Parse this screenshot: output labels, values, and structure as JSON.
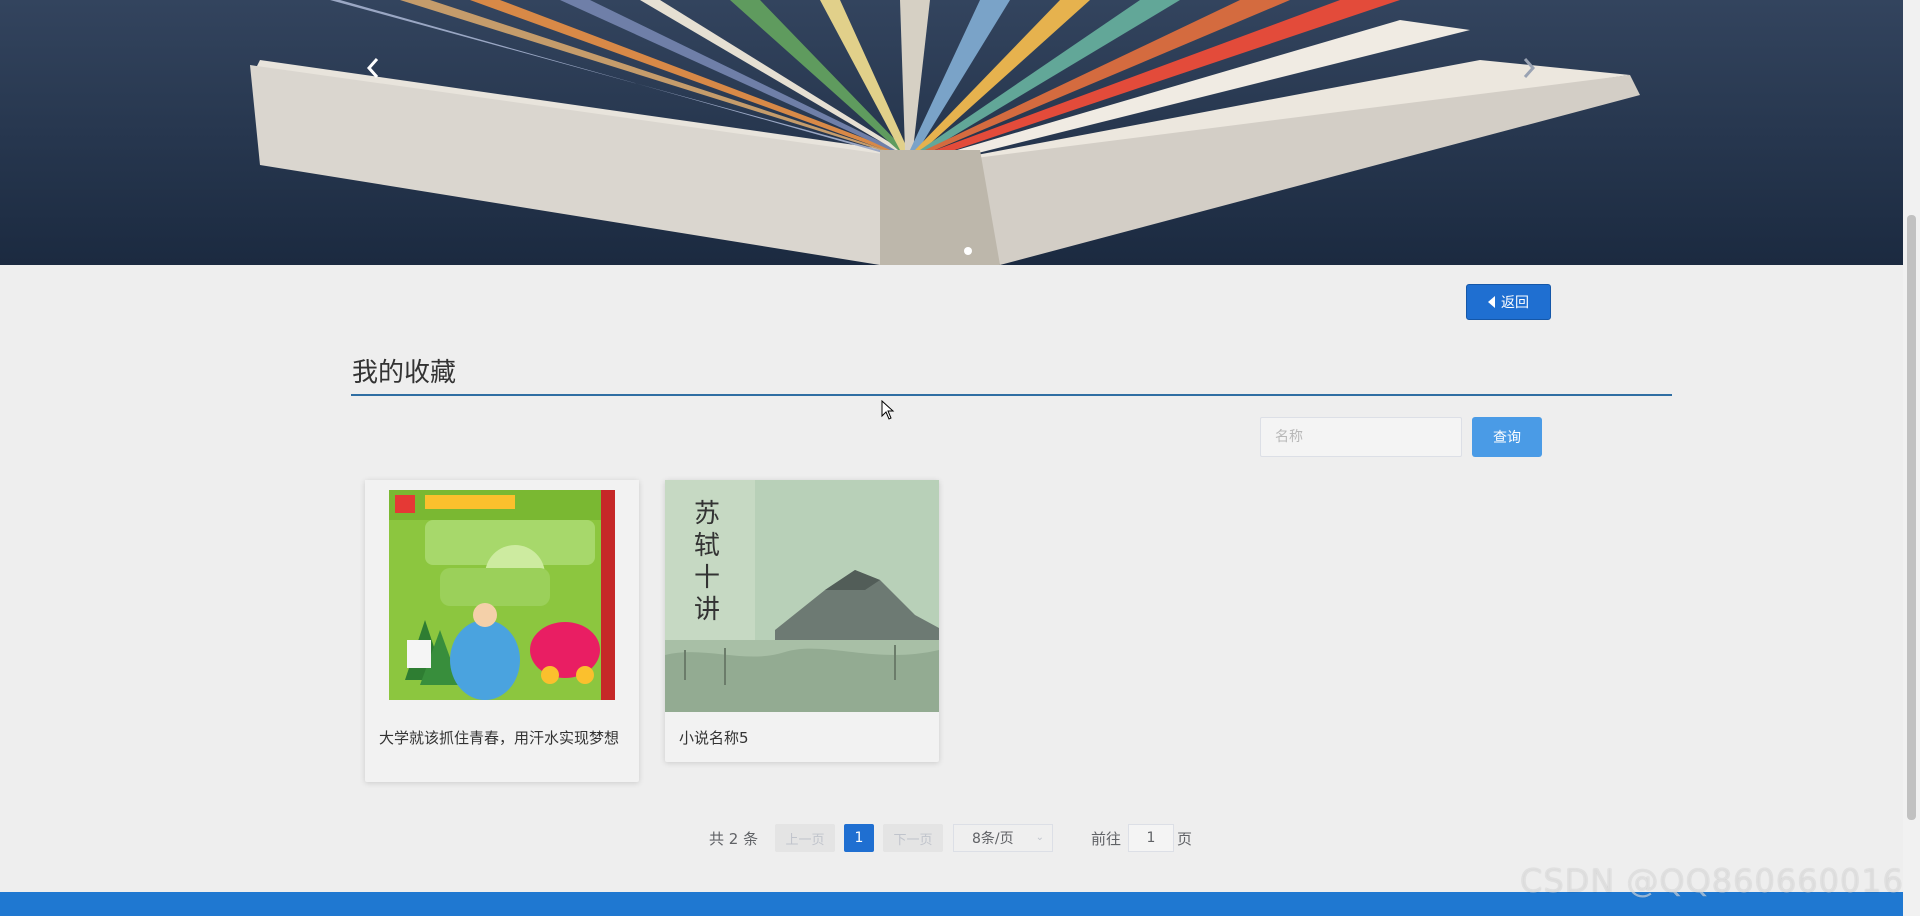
{
  "banner": {
    "prev_icon": "chevron-left-icon",
    "next_icon": "chevron-right-icon",
    "dots": 1
  },
  "back_button": {
    "label": "返回",
    "icon": "caret-left-icon"
  },
  "section": {
    "title": "我的收藏"
  },
  "search": {
    "placeholder": "名称",
    "value": "",
    "button_label": "查询"
  },
  "favorites": [
    {
      "name": "大学就该抓住青春，用汗水实现梦想"
    },
    {
      "name": "小说名称5"
    }
  ],
  "pagination": {
    "total_text": "共 2 条",
    "prev_label": "上一页",
    "next_label": "下一页",
    "current_page": "1",
    "page_size": "8条/页",
    "goto_label": "前往",
    "goto_value": "1",
    "goto_unit": "页"
  },
  "watermark": "CSDN @QQ860660016",
  "colors": {
    "primary": "#1f6fd1",
    "footer": "#1f78d1",
    "search_button": "#4a9be6",
    "title_line": "#2f6ea3"
  }
}
